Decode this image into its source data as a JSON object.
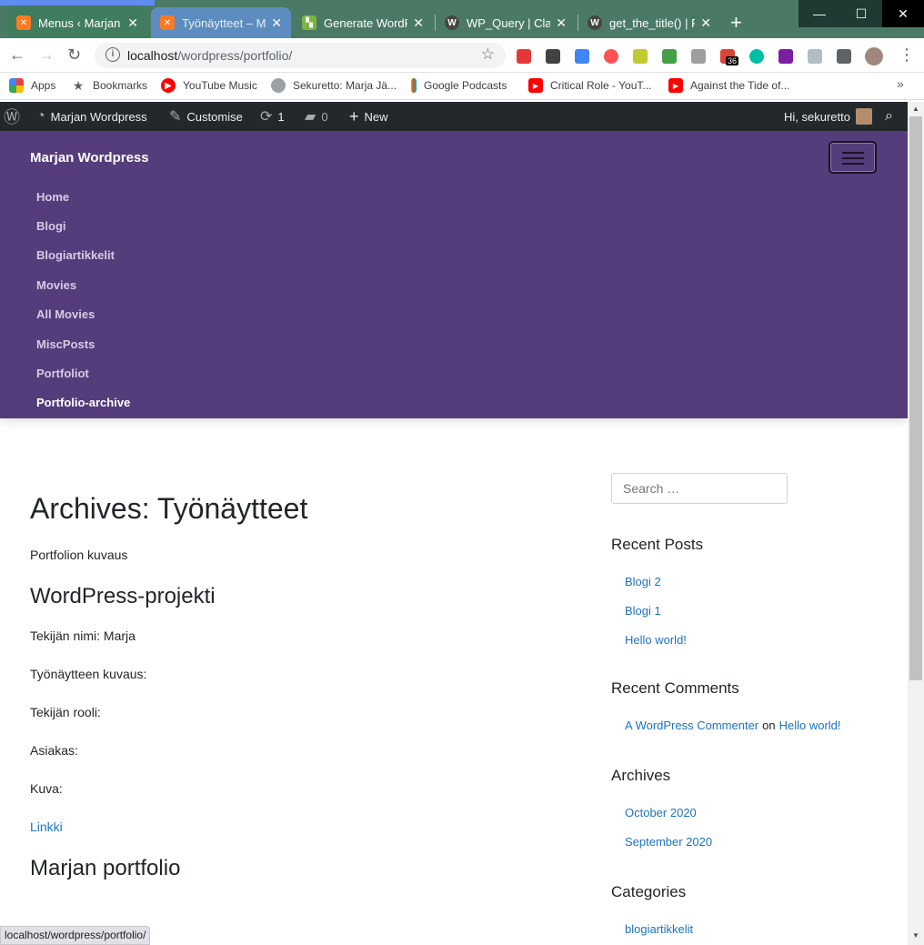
{
  "browser": {
    "tabs": [
      {
        "title": "Menus ‹ Marjan W",
        "favicon": "xampp-icon",
        "color": "#fb7a24"
      },
      {
        "title": "Työnäytteet – Ma",
        "favicon": "xampp-icon",
        "color": "#fb7a24"
      },
      {
        "title": "Generate WordPr",
        "favicon": "generatewp-icon",
        "color": "#7cb342"
      },
      {
        "title": "WP_Query | Class",
        "favicon": "wordpress-icon",
        "color": "#464646"
      },
      {
        "title": "get_the_title() | Fu",
        "favicon": "wordpress-icon",
        "color": "#464646"
      }
    ],
    "url_host": "localhost",
    "url_path": "/wordpress/portfolio/",
    "bookmarks": [
      {
        "label": "Apps",
        "icon": "apps-grid-icon"
      },
      {
        "label": "Bookmarks",
        "icon": "star-icon"
      },
      {
        "label": "YouTube Music",
        "icon": "youtube-music-icon"
      },
      {
        "label": "Sekuretto: Marja Jä...",
        "icon": "globe-icon"
      },
      {
        "label": "Google Podcasts",
        "icon": "google-podcasts-icon"
      },
      {
        "label": "Critical Role - YouT...",
        "icon": "youtube-icon"
      },
      {
        "label": "Against the Tide of...",
        "icon": "youtube-icon"
      }
    ],
    "extension_badge": "36",
    "status_url": "localhost/wordpress/portfolio/"
  },
  "adminbar": {
    "site_name": "Marjan Wordpress",
    "customise": "Customise",
    "updates": "1",
    "comments": "0",
    "new": "New",
    "greeting": "Hi, sekuretto"
  },
  "header": {
    "site_title": "Marjan Wordpress",
    "nav": [
      "Home",
      "Blogi",
      "Blogiartikkelit",
      "Movies",
      "All Movies",
      "MiscPosts",
      "Portfoliot",
      "Portfolio-archive"
    ],
    "accent": "#553c7b"
  },
  "main": {
    "archive_title": "Archives: Työnäytteet",
    "archive_description": "Portfolion kuvaus",
    "entries": [
      {
        "title": "WordPress-projekti",
        "fields": [
          "Tekijän nimi: Marja",
          "Työnäytteen kuvaus:",
          "Tekijän rooli:",
          "Asiakas:",
          "Kuva:"
        ],
        "link": "Linkki"
      },
      {
        "title": "Marjan portfolio"
      }
    ]
  },
  "sidebar": {
    "search_placeholder": "Search …",
    "recent_posts_title": "Recent Posts",
    "recent_posts": [
      "Blogi 2",
      "Blogi 1",
      "Hello world!"
    ],
    "recent_comments_title": "Recent Comments",
    "comment": {
      "author": "A WordPress Commenter",
      "on": "on",
      "post": "Hello world!"
    },
    "archives_title": "Archives",
    "archives": [
      "October 2020",
      "September 2020"
    ],
    "categories_title": "Categories",
    "categories": [
      "blogiartikkelit"
    ]
  }
}
